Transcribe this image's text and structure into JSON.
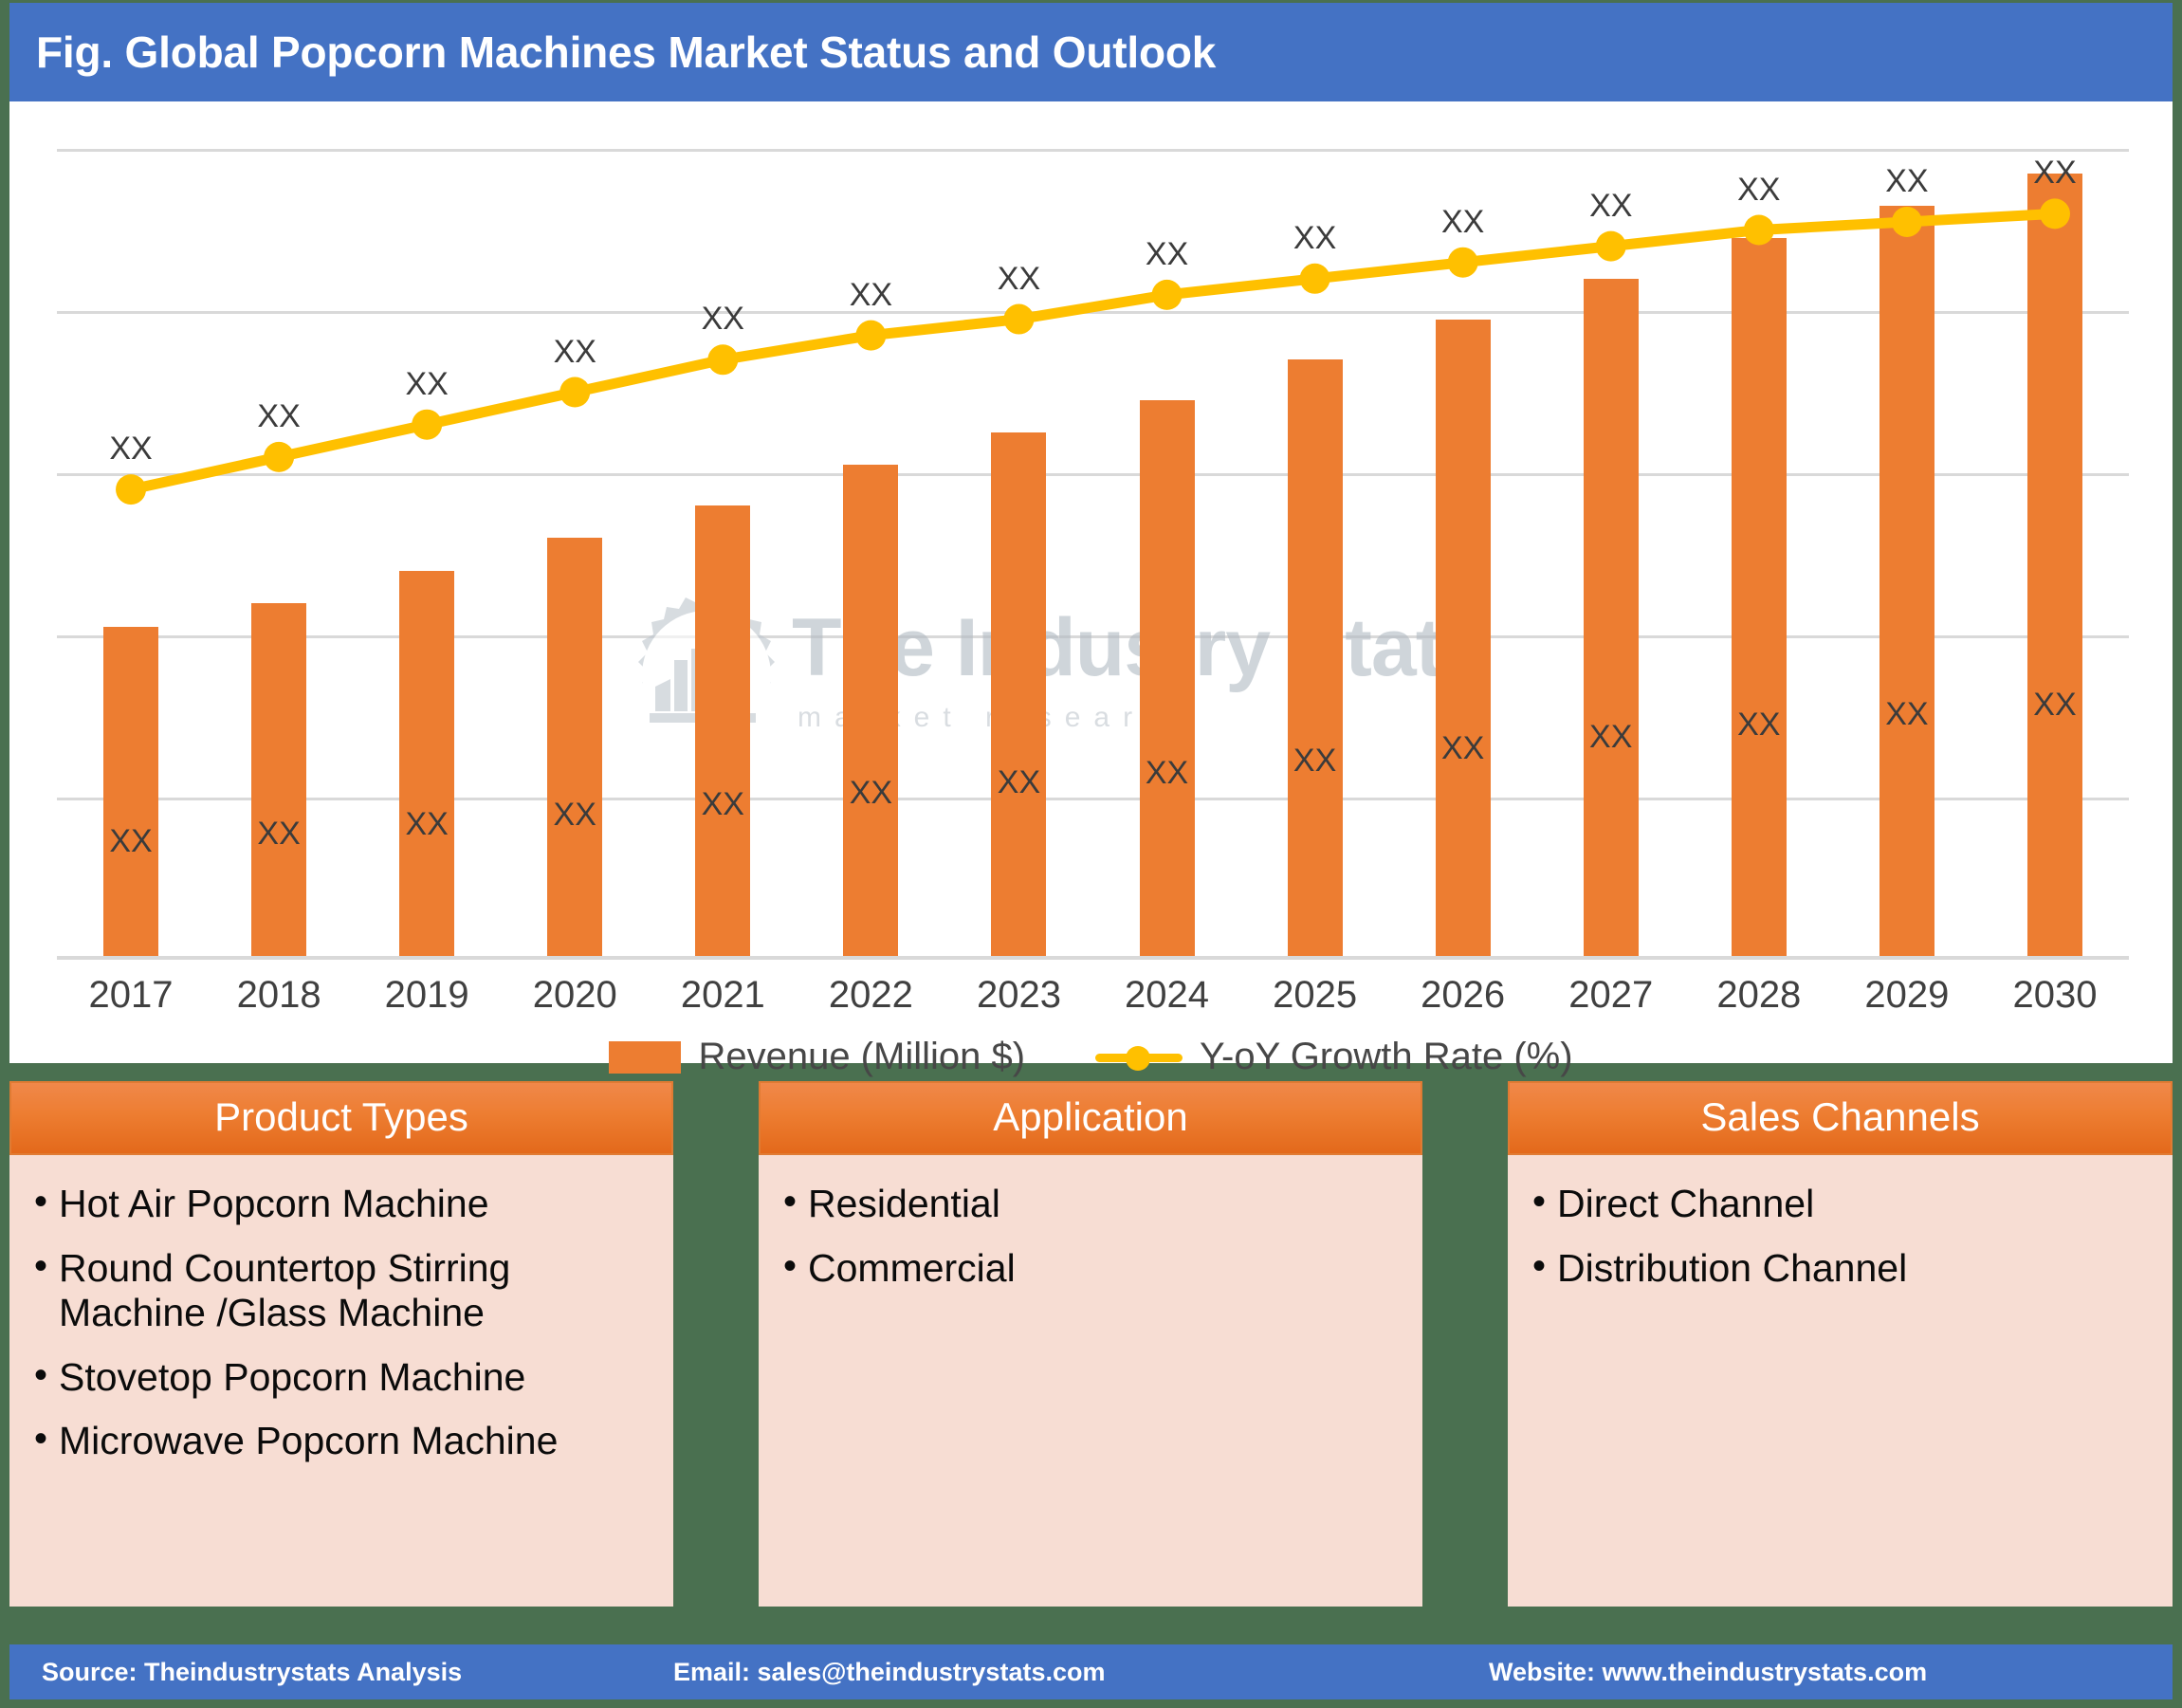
{
  "header": {
    "title": "Fig. Global Popcorn Machines Market Status and Outlook",
    "bg_color": "#4472C4"
  },
  "watermark": {
    "title": "The Industry Stats",
    "subtitle": "m a r k e t   r e s e a r c h",
    "logo_icon": "gear-factory-wrench-icon"
  },
  "chart_data": {
    "type": "bar",
    "title": "Fig. Global Popcorn Machines Market Status and Outlook",
    "xlabel": "",
    "ylabel": "",
    "grid": true,
    "legend_position": "bottom",
    "categories": [
      "2017",
      "2018",
      "2019",
      "2020",
      "2021",
      "2022",
      "2023",
      "2024",
      "2025",
      "2026",
      "2027",
      "2028",
      "2029",
      "2030"
    ],
    "ylim": [
      0,
      100
    ],
    "series": [
      {
        "name": "Revenue (Million $)",
        "type": "bar",
        "color": "#ED7D31",
        "axis": "left",
        "values": [
          41,
          44,
          48,
          52,
          56,
          61,
          65,
          69,
          74,
          79,
          84,
          89,
          93,
          97
        ],
        "data_labels": [
          "XX",
          "XX",
          "XX",
          "XX",
          "XX",
          "XX",
          "XX",
          "XX",
          "XX",
          "XX",
          "XX",
          "XX",
          "XX",
          "XX"
        ]
      },
      {
        "name": "Y-oY Growth Rate (%)",
        "type": "line",
        "color": "#FFC000",
        "axis": "right",
        "values": [
          58,
          62,
          66,
          70,
          74,
          77,
          79,
          82,
          84,
          86,
          88,
          90,
          91,
          92
        ],
        "data_labels": [
          "XX",
          "XX",
          "XX",
          "XX",
          "XX",
          "XX",
          "XX",
          "XX",
          "XX",
          "XX",
          "XX",
          "XX",
          "XX",
          "XX"
        ]
      }
    ],
    "legend": [
      {
        "label": "Revenue (Million $)",
        "marker": "square",
        "color": "#ED7D31"
      },
      {
        "label": "Y-oY Growth Rate (%)",
        "marker": "line-dot",
        "color": "#FFC000"
      }
    ]
  },
  "panels": [
    {
      "id": "product",
      "title": "Product Types",
      "items": [
        "Hot Air Popcorn Machine",
        "Round Countertop Stirring Machine /Glass Machine",
        "Stovetop Popcorn Machine",
        "Microwave Popcorn Machine"
      ]
    },
    {
      "id": "application",
      "title": "Application",
      "items": [
        "Residential",
        "Commercial"
      ]
    },
    {
      "id": "sales",
      "title": "Sales Channels",
      "items": [
        "Direct Channel",
        "Distribution Channel"
      ]
    }
  ],
  "footer": {
    "source": "Source: Theindustrystats Analysis",
    "email": "Email: sales@theindustrystats.com",
    "website": "Website: www.theindustrystats.com",
    "bg_color": "#4472C4"
  },
  "theme": {
    "frame_green": "#4A7050",
    "bar_orange": "#ED7D31",
    "line_yellow": "#FFC000",
    "panel_body_pink": "#F7DDD3",
    "gridline": "#D9D9D9"
  }
}
